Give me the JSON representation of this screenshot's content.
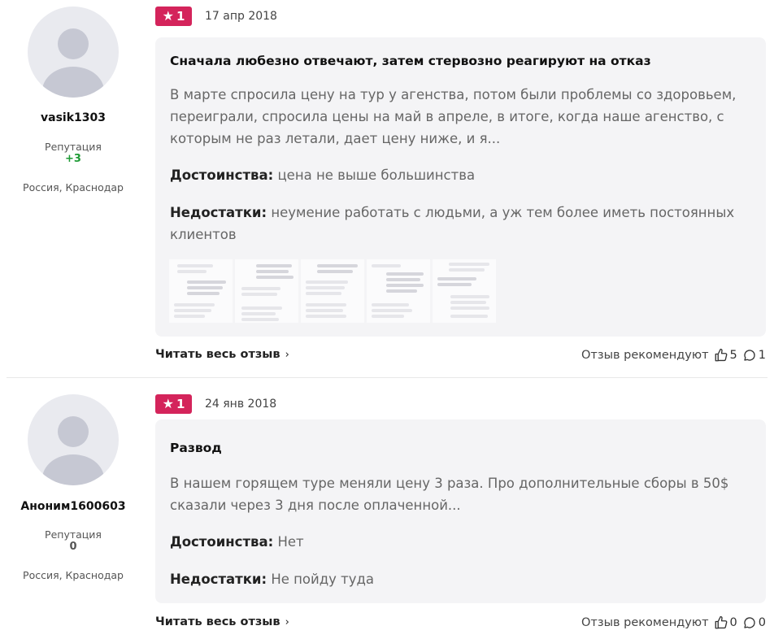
{
  "reviews": [
    {
      "user": {
        "name": "vasik1303",
        "reputation_label": "Репутация",
        "reputation": "+3",
        "city": "Россия, Краснодар"
      },
      "rating": "1",
      "date": "17 апр 2018",
      "title": "Сначала любезно отвечают, затем стервозно реагируют на отказ",
      "text": "В марте спросила цену на тур у агенства, потом были проблемы со здоровьем, переиграли, спросила цены на май в апреле, в итоге, когда наше агенство, с которым не раз летали, дает цену ниже, и я...",
      "pros_label": "Достоинства:",
      "pros": "цена не выше большинства",
      "cons_label": "Недостатки:",
      "cons": "неумение работать с людьми, а уж тем более иметь постоянных клиентов",
      "read_more": "Читать весь отзыв",
      "recommend_label": "Отзыв рекомендуют",
      "likes": "5",
      "comments": "1"
    },
    {
      "user": {
        "name": "Аноним1600603",
        "reputation_label": "Репутация",
        "reputation": "0",
        "city": "Россия, Краснодар"
      },
      "rating": "1",
      "date": "24 янв 2018",
      "title": "Развод",
      "text": "В нашем горящем туре меняли цену 3 раза. Про дополнительные сборы в 50$ сказали через 3 дня после оплаченной...",
      "pros_label": "Достоинства:",
      "pros": "Нет",
      "cons_label": "Недостатки:",
      "cons": "Не пойду туда",
      "read_more": "Читать весь отзыв",
      "recommend_label": "Отзыв рекомендуют",
      "likes": "0",
      "comments": "0"
    }
  ],
  "colors": {
    "badge": "#d4245b",
    "positive_rep": "#1e9a35",
    "card_bg": "#f4f4f6"
  },
  "icons": {
    "rating": "star-icon",
    "like": "thumbs-up-icon",
    "comment": "comment-icon",
    "more": "chevron-right-icon"
  }
}
